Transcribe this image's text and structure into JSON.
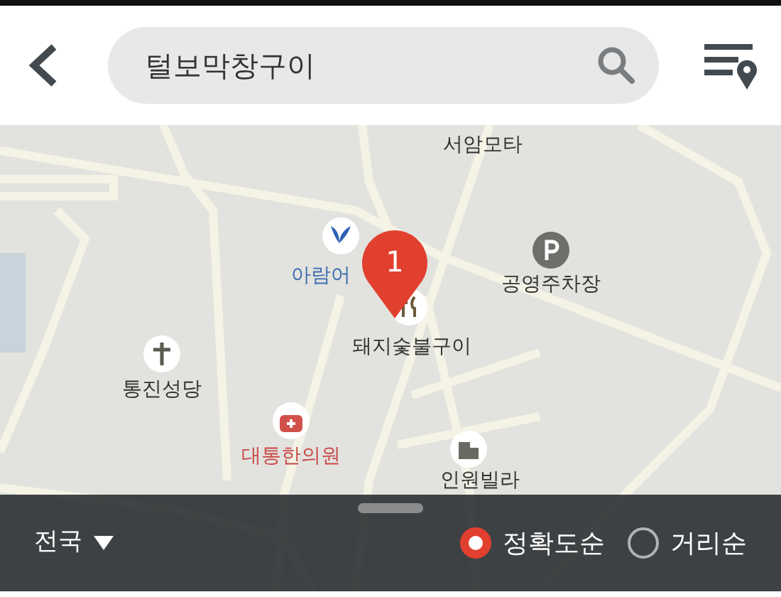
{
  "header": {
    "search_value": "털보막창구이"
  },
  "map": {
    "pin_label": "1",
    "places": [
      {
        "name": "서암모타",
        "kind": "plain"
      },
      {
        "name": "아람어",
        "kind": "leaf"
      },
      {
        "name": "돼지숯불구이",
        "kind": "restaurant"
      },
      {
        "name": "공영주차장",
        "kind": "parking"
      },
      {
        "name": "통진성당",
        "kind": "church"
      },
      {
        "name": "대통한의원",
        "kind": "clinic"
      },
      {
        "name": "인원빌라",
        "kind": "building"
      }
    ]
  },
  "bottom_bar": {
    "region": "전국",
    "sort_options": [
      {
        "label": "정확도순",
        "selected": true
      },
      {
        "label": "거리순",
        "selected": false
      }
    ]
  }
}
